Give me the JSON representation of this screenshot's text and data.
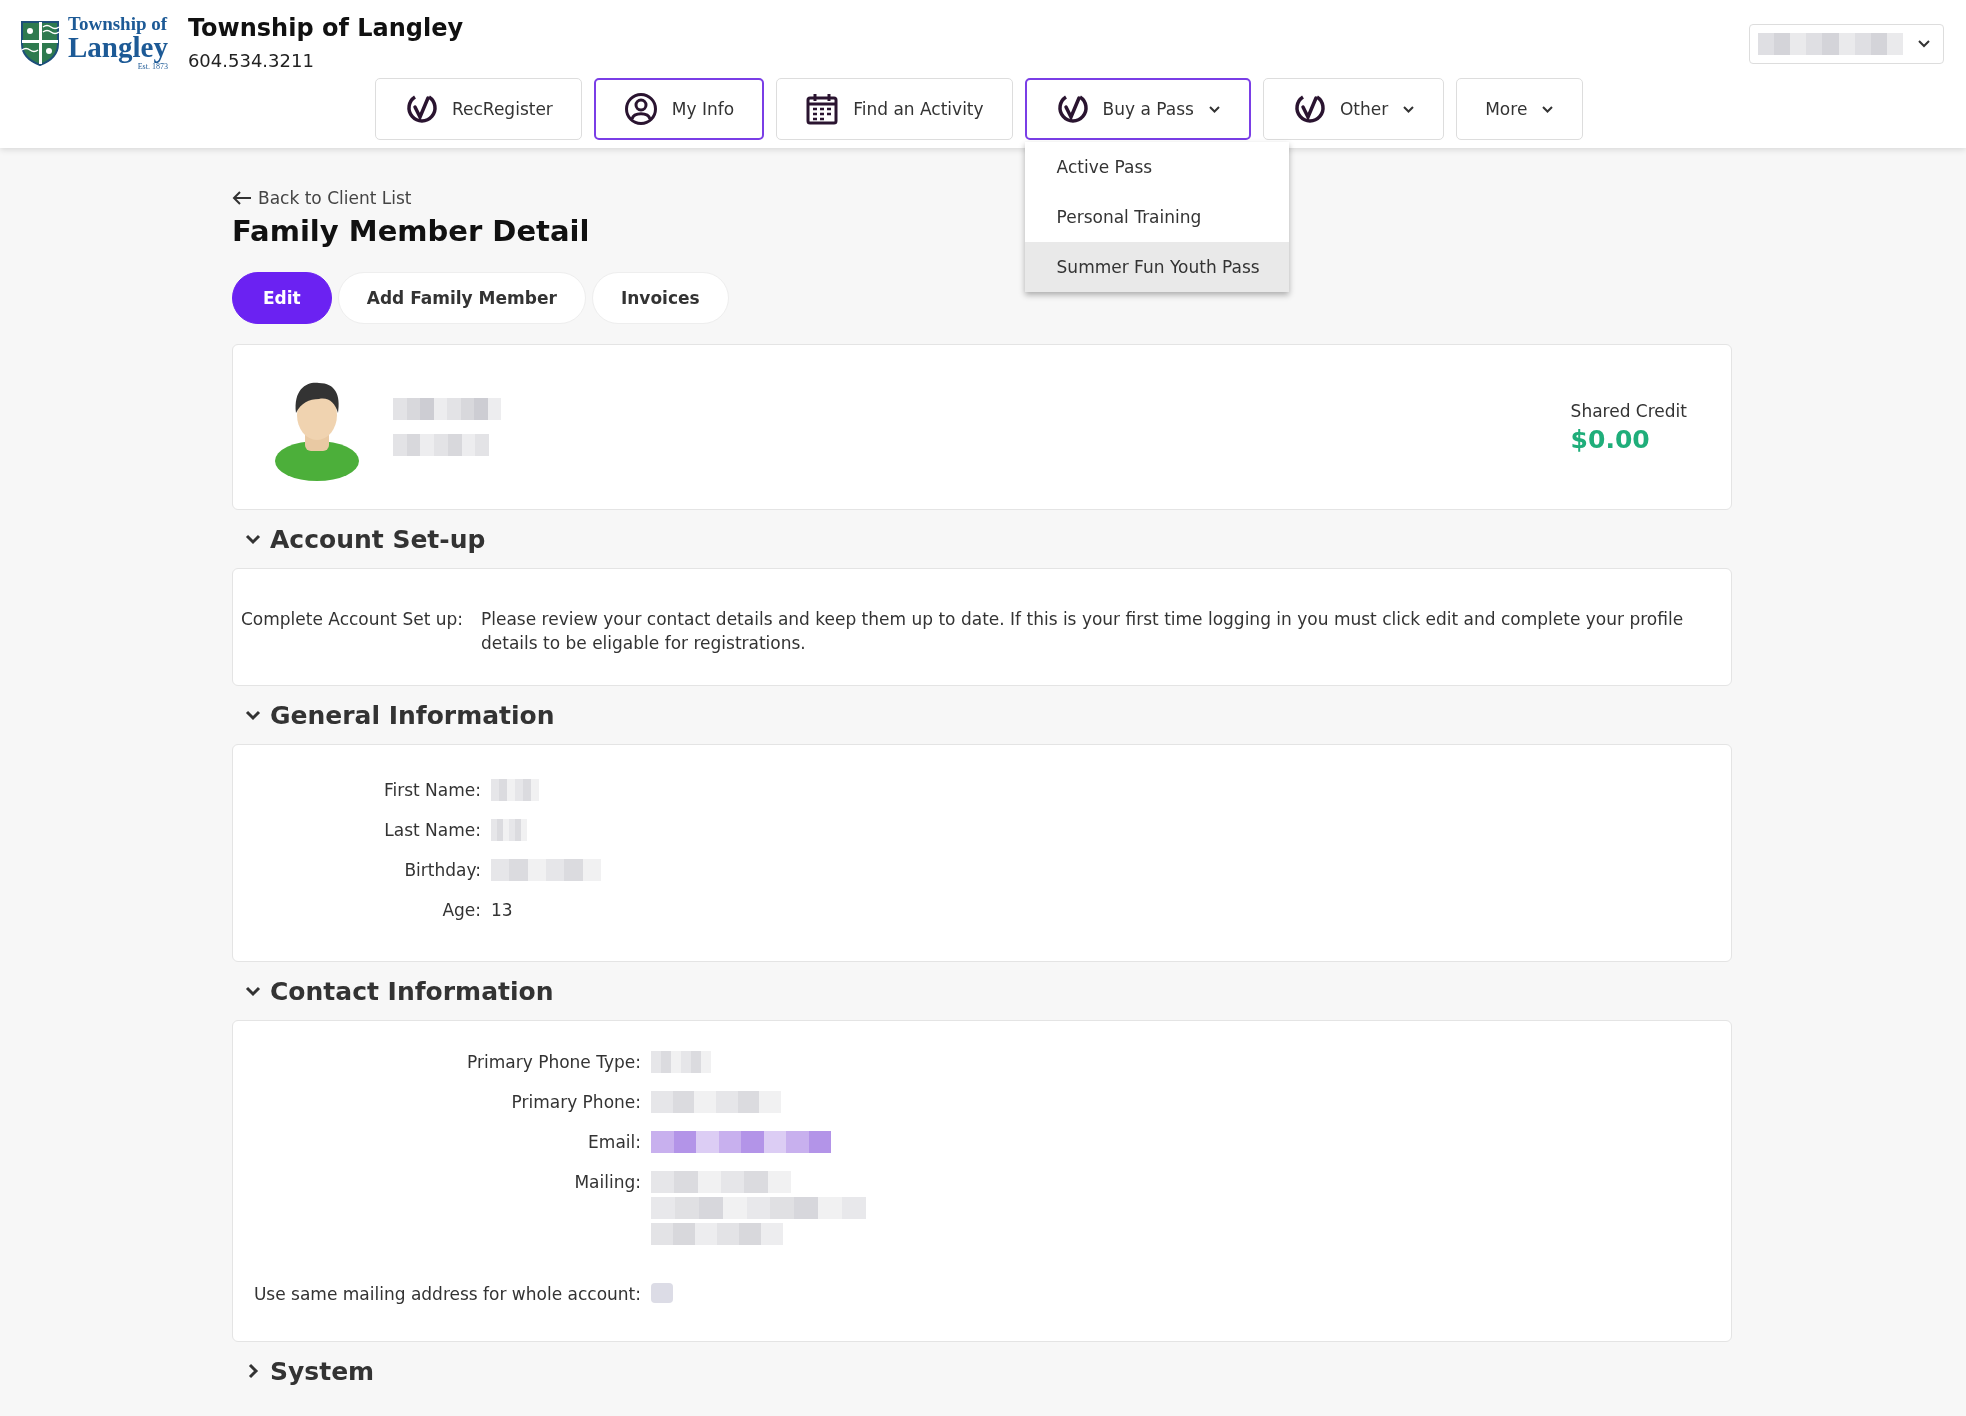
{
  "brand": {
    "logo_top": "Township of",
    "logo_main": "Langley",
    "logo_est": "Est. 1873",
    "title": "Township of Langley",
    "phone": "604.534.3211"
  },
  "nav": [
    {
      "label": "RecRegister",
      "caret": false,
      "selected": false
    },
    {
      "label": "My Info",
      "caret": false,
      "selected": true
    },
    {
      "label": "Find an Activity",
      "caret": false,
      "selected": false
    },
    {
      "label": "Buy a Pass",
      "caret": true,
      "selected": true
    },
    {
      "label": "Other",
      "caret": true,
      "selected": false
    },
    {
      "label": "More",
      "caret": true,
      "selected": false
    }
  ],
  "dropdown": {
    "items": [
      {
        "label": "Active Pass",
        "selected": false
      },
      {
        "label": "Personal Training",
        "selected": false
      },
      {
        "label": "Summer Fun Youth Pass",
        "selected": true
      }
    ]
  },
  "back_link": "Back to Client List",
  "page_title": "Family Member Detail",
  "actions": [
    {
      "label": "Edit",
      "primary": true
    },
    {
      "label": "Add Family Member",
      "primary": false
    },
    {
      "label": "Invoices",
      "primary": false
    }
  ],
  "profile": {
    "credit_label": "Shared Credit",
    "credit_value": "$0.00"
  },
  "sections": [
    {
      "title": "Account Set-up",
      "expanded": true,
      "kind": "note",
      "label": "Complete Account Set up:",
      "text": "Please review your contact details and keep them up to date.  If this is your first time logging in you must click edit and complete your profile details to be eligable for registrations."
    },
    {
      "title": "General Information",
      "expanded": true,
      "kind": "fields",
      "fields": [
        {
          "label": "First Name:",
          "kind": "redacted"
        },
        {
          "label": "Last Name:",
          "kind": "redacted"
        },
        {
          "label": "Birthday:",
          "kind": "redacted"
        },
        {
          "label": "Age:",
          "kind": "text",
          "value": "13"
        }
      ]
    },
    {
      "title": "Contact Information",
      "expanded": true,
      "kind": "fields",
      "fields": [
        {
          "label": "Primary Phone Type:",
          "kind": "redacted"
        },
        {
          "label": "Primary Phone:",
          "kind": "redacted"
        },
        {
          "label": "Email:",
          "kind": "redacted_link"
        },
        {
          "label": "Mailing:",
          "kind": "redacted_block"
        },
        {
          "label": "Use same mailing address for whole account:",
          "kind": "checkbox",
          "checked": false
        }
      ]
    },
    {
      "title": "System",
      "expanded": false
    }
  ]
}
